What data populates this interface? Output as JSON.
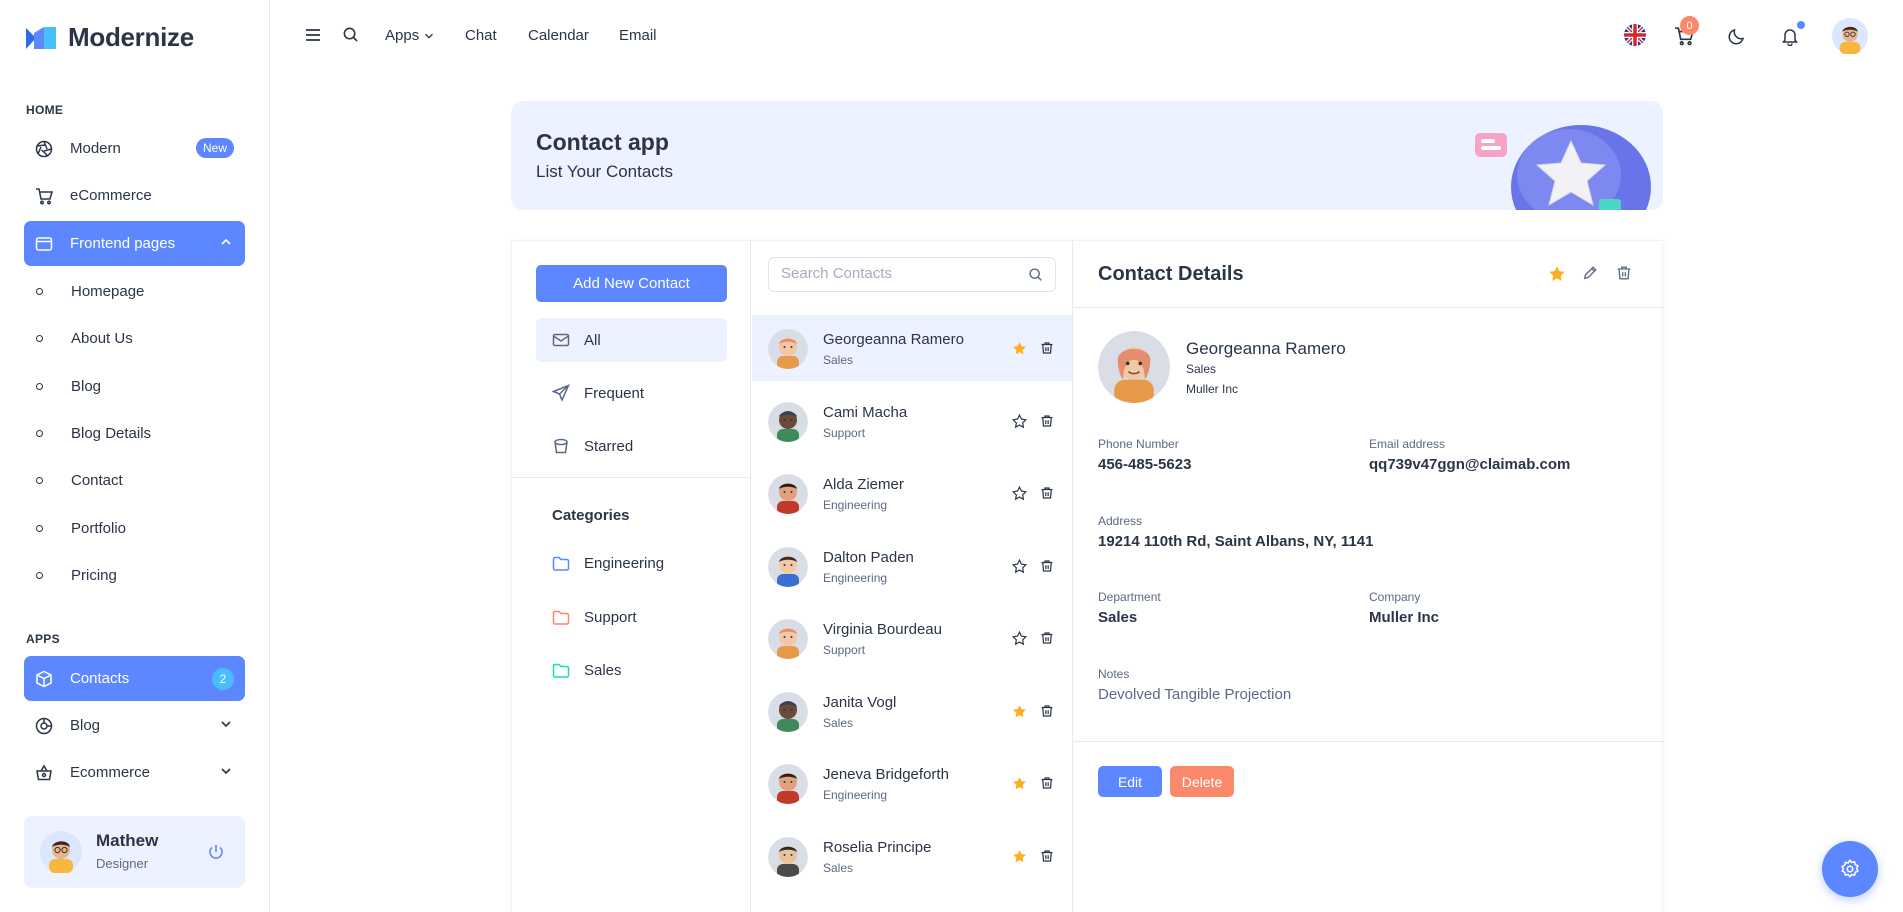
{
  "brand": {
    "name": "Modernize"
  },
  "sidebar": {
    "home_caption": "HOME",
    "apps_caption": "APPS",
    "items": [
      {
        "label": "Modern",
        "badge": "New"
      },
      {
        "label": "eCommerce"
      },
      {
        "label": "Frontend pages"
      },
      {
        "label": "Contacts",
        "badge": "2"
      },
      {
        "label": "Blog"
      },
      {
        "label": "Ecommerce"
      }
    ],
    "sub_items": [
      "Homepage",
      "About Us",
      "Blog",
      "Blog Details",
      "Contact",
      "Portfolio",
      "Pricing"
    ]
  },
  "profile": {
    "name": "Mathew",
    "role": "Designer"
  },
  "header": {
    "links": [
      "Apps",
      "Chat",
      "Calendar",
      "Email"
    ],
    "cart_count": "0"
  },
  "banner": {
    "title": "Contact app",
    "subtitle": "List Your Contacts"
  },
  "contacts_app": {
    "add_button": "Add New Contact",
    "filters": [
      "All",
      "Frequent",
      "Starred"
    ],
    "categories_title": "Categories",
    "categories": [
      "Engineering",
      "Support",
      "Sales"
    ],
    "search_placeholder": "Search Contacts",
    "list": [
      {
        "name": "Georgeanna Ramero",
        "dept": "Sales",
        "starred": true
      },
      {
        "name": "Cami Macha",
        "dept": "Support",
        "starred": false
      },
      {
        "name": "Alda Ziemer",
        "dept": "Engineering",
        "starred": false
      },
      {
        "name": "Dalton Paden",
        "dept": "Engineering",
        "starred": false
      },
      {
        "name": "Virginia Bourdeau",
        "dept": "Support",
        "starred": false
      },
      {
        "name": "Janita Vogl",
        "dept": "Sales",
        "starred": true
      },
      {
        "name": "Jeneva Bridgeforth",
        "dept": "Engineering",
        "starred": true
      },
      {
        "name": "Roselia Principe",
        "dept": "Sales",
        "starred": true
      }
    ],
    "details": {
      "heading": "Contact Details",
      "name": "Georgeanna Ramero",
      "dept": "Sales",
      "company": "Muller Inc",
      "phone_label": "Phone Number",
      "phone": "456-485-5623",
      "email_label": "Email address",
      "email": "qq739v47ggn@claimab.com",
      "address_label": "Address",
      "address": "19214 110th Rd, Saint Albans, NY, 1141",
      "department_label": "Department",
      "department": "Sales",
      "company_label": "Company",
      "company_value": "Muller Inc",
      "notes_label": "Notes",
      "notes": "Devolved Tangible Projection",
      "edit_button": "Edit",
      "delete_button": "Delete"
    }
  },
  "colors": {
    "primary": "#5d87ff",
    "primary_light": "#ecf2ff",
    "danger": "#fa896b",
    "star": "#ffae1f",
    "info": "#49beff"
  }
}
